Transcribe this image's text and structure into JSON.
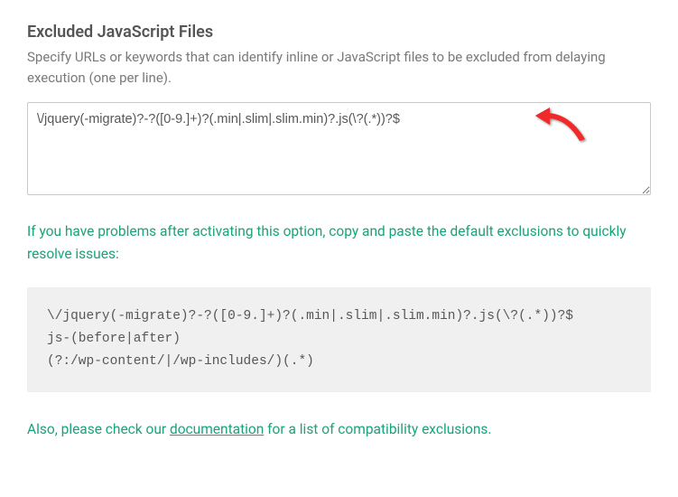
{
  "section": {
    "title": "Excluded JavaScript Files",
    "description": "Specify URLs or keywords that can identify inline or JavaScript files to be excluded from delaying execution (one per line)."
  },
  "textarea": {
    "value": "\\/jquery(-migrate)?-?([0-9.]+)?(.min|.slim|.slim.min)?.js(\\?(.*))?$"
  },
  "hint1": "If you have problems after activating this option, copy and paste the default exclusions to quickly resolve issues:",
  "code": "\\/jquery(-migrate)?-?([0-9.]+)?(.min|.slim|.slim.min)?.js(\\?(.*))?$\njs-(before|after)\n(?:/wp-content/|/wp-includes/)(.*)",
  "footer": {
    "prefix": "Also, please check our ",
    "link_text": "documentation",
    "suffix": " for a list of compatibility exclusions."
  }
}
